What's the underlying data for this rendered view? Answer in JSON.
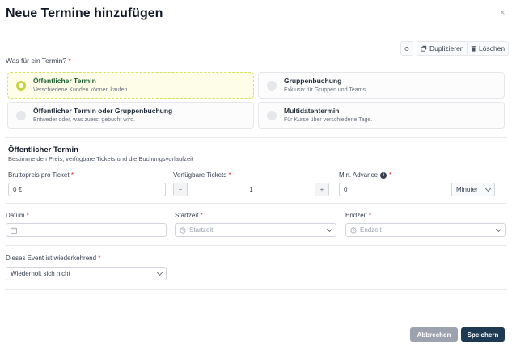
{
  "modal": {
    "title": "Neue Termine hinzufügen",
    "close_glyph": "×"
  },
  "toolbar": {
    "refresh_label": "",
    "duplicate_label": "Duplizieren",
    "delete_label": "Löschen"
  },
  "event_type": {
    "question": "Was für ein Termin?",
    "required_mark": "*",
    "options": [
      {
        "title": "Öffentlicher Termin",
        "subtitle": "Verschiedene Kunden können kaufen.",
        "selected": true
      },
      {
        "title": "Gruppenbuchung",
        "subtitle": "Exklusiv für Gruppen und Teams.",
        "selected": false
      },
      {
        "title": "Öffentlicher Termin oder Gruppenbuchung",
        "subtitle": "Entweder oder, was zuerst gebucht wird.",
        "selected": false
      },
      {
        "title": "Multidatentermin",
        "subtitle": "Für Kurse über verschiedene Tage.",
        "selected": false
      }
    ]
  },
  "section": {
    "title": "Öffentlicher Termin",
    "subtitle": "Bestimme den Preis, verfügbare Tickets und die Buchungsvorlaufzeit"
  },
  "fields": {
    "price": {
      "label": "Bruttopreis pro Ticket",
      "value": "0 €"
    },
    "tickets": {
      "label": "Verfügbare Tickets",
      "value": "1",
      "minus": "−",
      "plus": "+"
    },
    "advance": {
      "label": "Min. Advance",
      "info": "i",
      "value": "0",
      "unit": "Minuter"
    },
    "date": {
      "label": "Datum",
      "value": ""
    },
    "start": {
      "label": "Startzeit",
      "placeholder": "Startzeit"
    },
    "end": {
      "label": "Endzeit",
      "placeholder": "Endzeit"
    },
    "recurring": {
      "label": "Dieses Event ist wiederkehrend",
      "value": "Wiederholt sich nicht"
    }
  },
  "footer": {
    "cancel_label": "Abbrechen",
    "save_label": "Speichern"
  },
  "colors": {
    "selected_accent": "#c3d43c",
    "save_button": "#1e3a52",
    "cancel_button": "#9ca3af",
    "required": "#dc2626"
  }
}
